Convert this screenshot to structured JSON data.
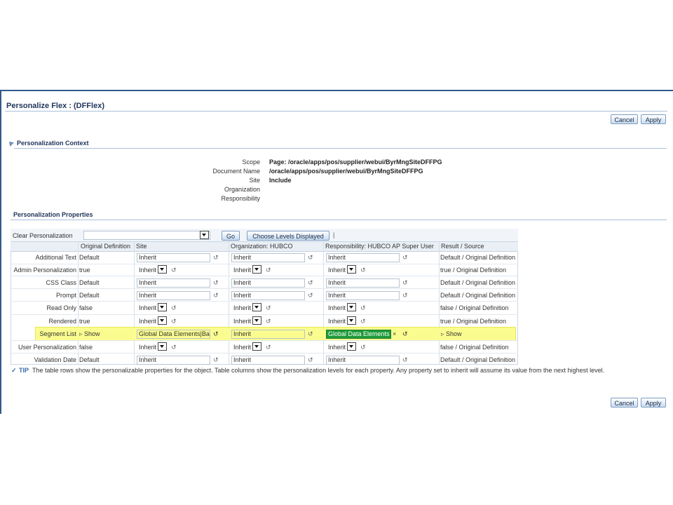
{
  "page": {
    "title": "Personalize Flex : (DFFlex)"
  },
  "buttons": {
    "cancel": "Cancel",
    "apply": "Apply",
    "go": "Go",
    "choose_levels": "Choose Levels Displayed"
  },
  "context": {
    "heading": "Personalization Context",
    "rows": [
      {
        "label": "Scope",
        "value": "Page: /oracle/apps/pos/supplier/webui/ByrMngSiteDFFPG"
      },
      {
        "label": "Document Name",
        "value": "/oracle/apps/pos/supplier/webui/ByrMngSiteDFFPG"
      },
      {
        "label": "Site",
        "value": "Include"
      },
      {
        "label": "Organization",
        "value": ""
      },
      {
        "label": "Responsibility",
        "value": ""
      }
    ]
  },
  "properties": {
    "heading": "Personalization Properties",
    "clear_label": "Clear Personalization",
    "clear_value": "",
    "columns": [
      "Original Definition",
      "Site",
      "Organization: HUBCO",
      "Responsibility: HUBCO AP Super User",
      "Result / Source"
    ],
    "rows": [
      {
        "name": "Additional Text",
        "orig": "Default",
        "site": "Inherit",
        "org": "Inherit",
        "resp": "Inherit",
        "result": "Default / Original Definition"
      },
      {
        "name": "Admin Personalization",
        "orig": "true",
        "site": "Inherit",
        "org": "Inherit",
        "resp": "Inherit",
        "result": "true / Original Definition"
      },
      {
        "name": "CSS Class",
        "orig": "Default",
        "site": "Inherit",
        "org": "Inherit",
        "resp": "Inherit",
        "result": "Default / Original Definition"
      },
      {
        "name": "Prompt",
        "orig": "Default",
        "site": "Inherit",
        "org": "Inherit",
        "resp": "Inherit",
        "result": "Default / Original Definition"
      },
      {
        "name": "Read Only",
        "orig": "false",
        "site": "Inherit",
        "org": "Inherit",
        "resp": "Inherit",
        "result": "false / Original Definition"
      },
      {
        "name": "Rendered",
        "orig": "true",
        "site": "Inherit",
        "org": "Inherit",
        "resp": "Inherit",
        "result": "true / Original Definition"
      },
      {
        "name": "Segment List",
        "orig": "Show",
        "site": "Global Data Elements|Ba",
        "org": "Inherit",
        "resp": "Global Data Elements",
        "result": "Show"
      },
      {
        "name": "User Personalization",
        "orig": "false",
        "site": "Inherit",
        "org": "Inherit",
        "resp": "Inherit",
        "result": "false / Original Definition"
      },
      {
        "name": "Validation Date",
        "orig": "Default",
        "site": "Inherit",
        "org": "Inherit",
        "resp": "Inherit",
        "result": "Default / Original Definition"
      }
    ]
  },
  "tip": {
    "label": "TIP",
    "text": "The table rows show the personalizable properties for the object. Table columns show the personalization levels for each property. Any property set to inherit will assume its value from the next highest level."
  },
  "colors": {
    "highlight": "#fbfc8f",
    "header_text": "#21365b",
    "selected_bg": "#1e9b3a"
  }
}
